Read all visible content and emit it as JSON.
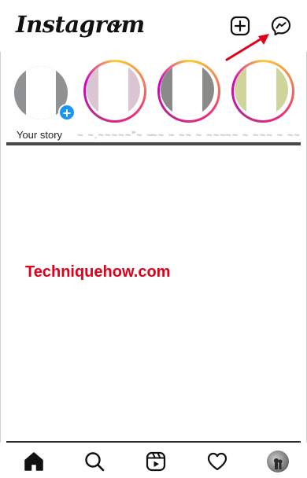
{
  "header": {
    "brand": "Instagram",
    "new_post_icon": "plus-square-icon",
    "messages_icon": "messenger-icon"
  },
  "stories": [
    {
      "label": "Your story",
      "own": true,
      "photo_color": "#8f9192"
    },
    {
      "label": "~ ~.~~~~~\"~ ~ ~ ~\"~~ ~",
      "own": false,
      "photo_color": "#d9c6d2"
    },
    {
      "label": "~~ ~ ~~ ~ ~~~ ~",
      "own": false,
      "photo_color": "#8a8a88"
    },
    {
      "label": "~~ ~ ~~~ ~ ~~",
      "own": false,
      "photo_color": "#cfd59a"
    }
  ],
  "watermark": "Techniquehow.com",
  "nav": {
    "home": "home-icon",
    "search": "search-icon",
    "reels": "reels-icon",
    "activity": "heart-icon",
    "profile": "profile-avatar"
  },
  "colors": {
    "accent_blue": "#1b95f0",
    "annotation_red": "#e0001b",
    "text": "#111111"
  }
}
